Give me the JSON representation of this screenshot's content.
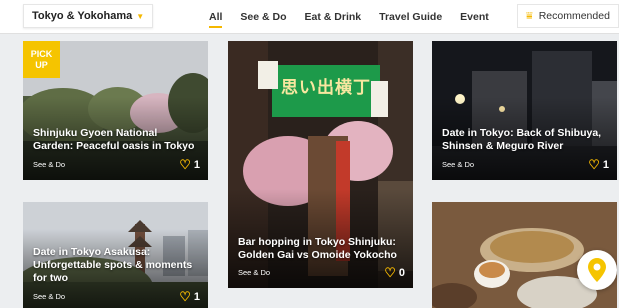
{
  "header": {
    "location": "Tokyo & Yokohama",
    "tabs": [
      {
        "label": "All",
        "active": true
      },
      {
        "label": "See & Do"
      },
      {
        "label": "Eat & Drink"
      },
      {
        "label": "Travel Guide"
      },
      {
        "label": "Event"
      }
    ],
    "sort_label": "Recommended"
  },
  "accent_color": "#f5b800",
  "cards": [
    {
      "badge": "PICK UP",
      "title": "Shinjuku Gyoen National Garden: Peaceful oasis in Tokyo",
      "category": "See & Do",
      "likes": "1"
    },
    {
      "title": "Bar hopping in Tokyo Shinjuku: Golden Gai vs Omoide Yokocho",
      "category": "See & Do",
      "likes": "0",
      "sign_text": "思い出横丁"
    },
    {
      "title": "Date in Tokyo: Back of Shibuya, Shinsen & Meguro River",
      "category": "See & Do",
      "likes": "1"
    },
    {
      "title": "Date in Tokyo Asakusa: Unforgettable spots & moments for two",
      "category": "See & Do",
      "likes": "1"
    },
    {
      "title": "",
      "category": "",
      "likes": ""
    }
  ]
}
